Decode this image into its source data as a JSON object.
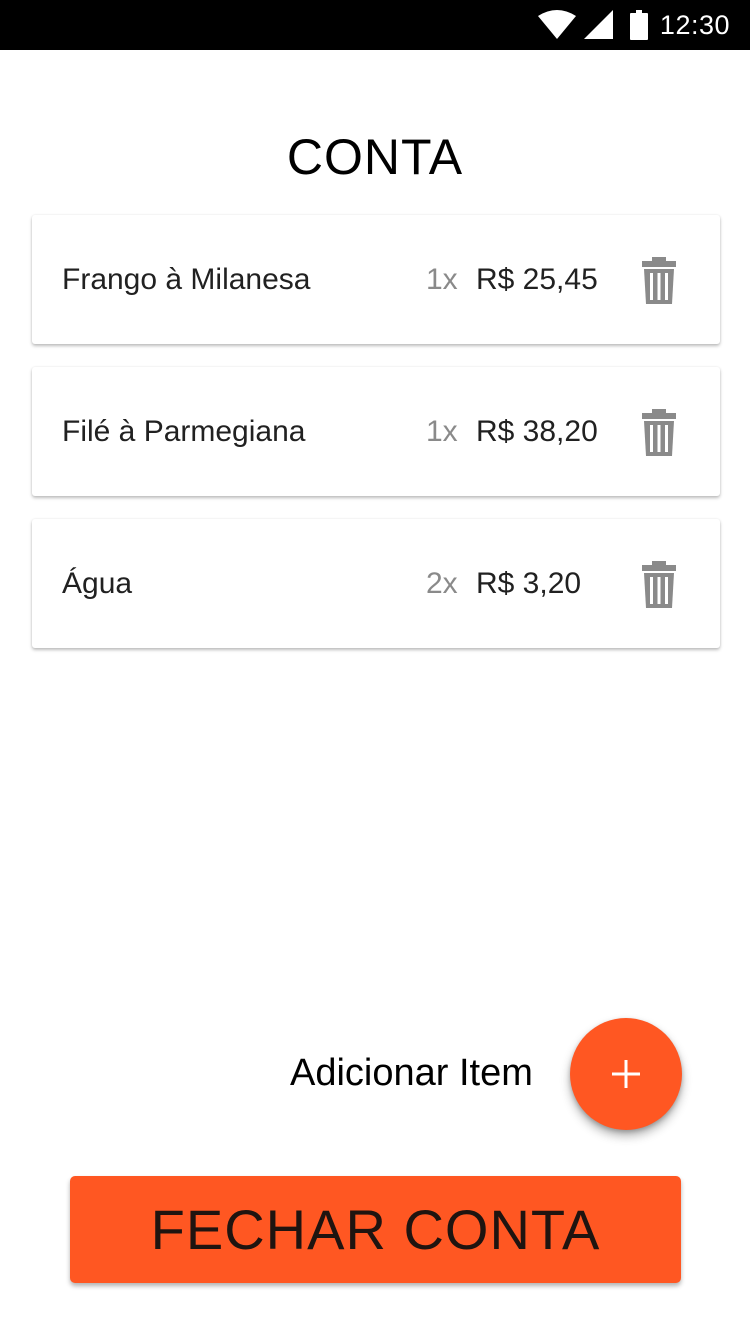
{
  "status_bar": {
    "time": "12:30",
    "icons": [
      "wifi-icon",
      "signal-icon",
      "battery-icon"
    ]
  },
  "page": {
    "title": "CONTA"
  },
  "items": [
    {
      "name": "Frango à Milanesa",
      "qty": "1x",
      "price": "R$ 25,45",
      "icon": "trash-icon"
    },
    {
      "name": "Filé à Parmegiana",
      "qty": "1x",
      "price": "R$ 38,20",
      "icon": "trash-icon"
    },
    {
      "name": "Água",
      "qty": "2x",
      "price": "R$ 3,20",
      "icon": "trash-icon"
    }
  ],
  "add_item": {
    "label": "Adicionar Item",
    "icon": "plus-icon"
  },
  "close_button": {
    "label": "FECHAR CONTA"
  },
  "colors": {
    "accent": "#ff5722",
    "status_bar": "#000000",
    "icon_gray": "#8a8a8a"
  }
}
